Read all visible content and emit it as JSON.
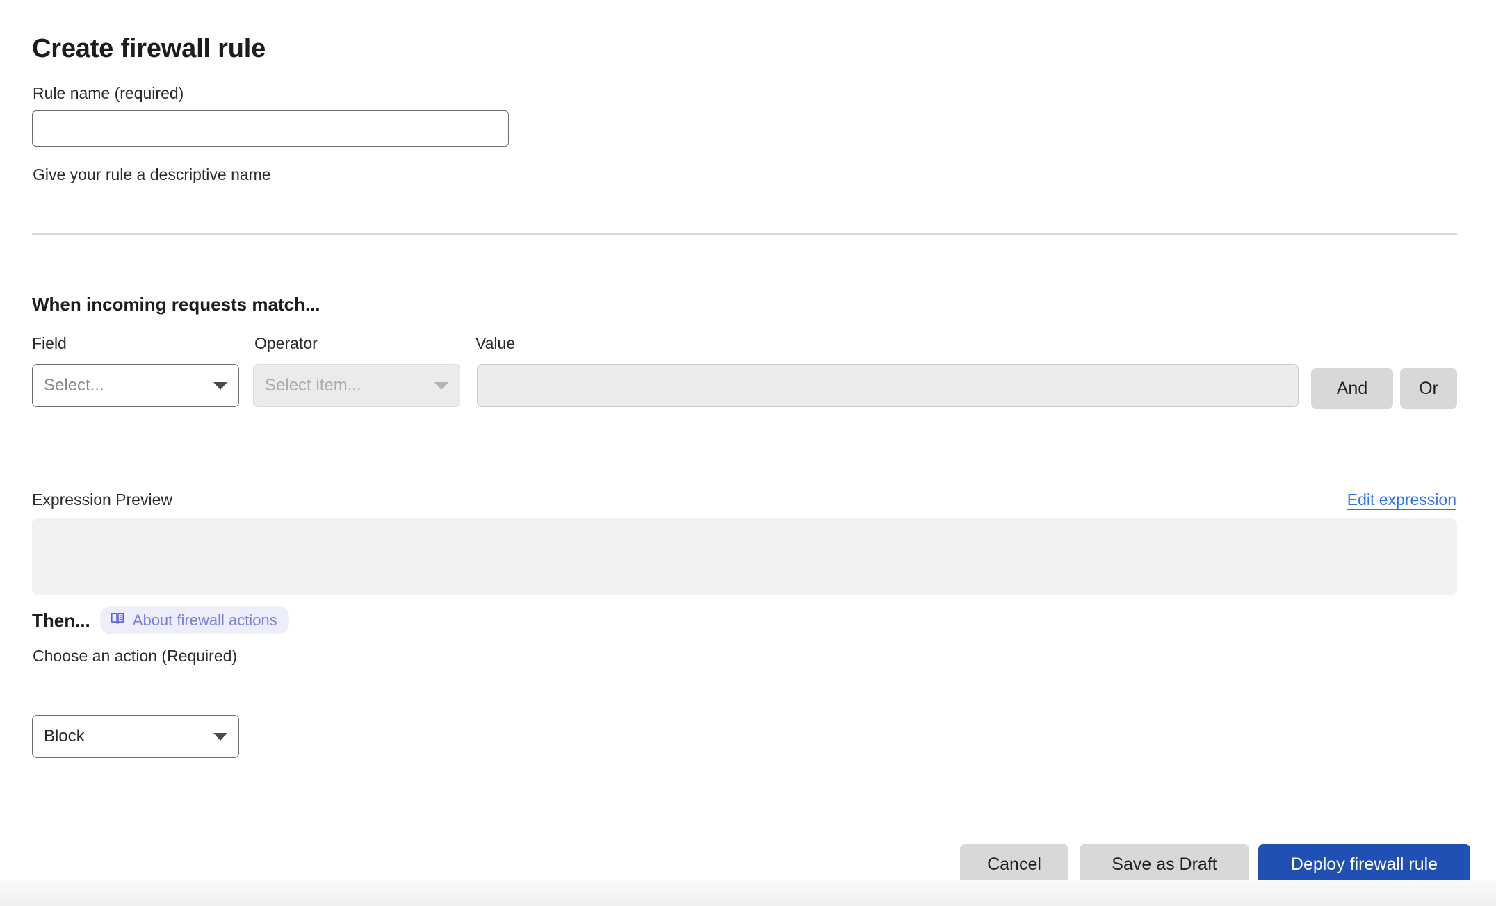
{
  "header": {
    "title": "Create firewall rule"
  },
  "rule_name": {
    "label": "Rule name (required)",
    "value": "",
    "placeholder": "",
    "help_text": "Give your rule a descriptive name"
  },
  "match_section": {
    "heading": "When incoming requests match...",
    "columns": {
      "field": "Field",
      "operator": "Operator",
      "value": "Value"
    },
    "field_select": {
      "value": "Select...",
      "state": "enabled"
    },
    "operator_select": {
      "value": "Select item...",
      "state": "disabled"
    },
    "value_input": {
      "value": "",
      "placeholder": "",
      "state": "disabled"
    },
    "logic_buttons": {
      "and": "And",
      "or": "Or"
    }
  },
  "expression": {
    "label": "Expression Preview",
    "edit_link": "Edit expression",
    "preview_text": ""
  },
  "then_section": {
    "heading": "Then...",
    "badge": {
      "icon": "book-icon",
      "label": "About firewall actions"
    },
    "action_label": "Choose an action (Required)",
    "action_select": {
      "value": "Block"
    }
  },
  "footer": {
    "cancel": "Cancel",
    "save_draft": "Save as Draft",
    "deploy": "Deploy firewall rule"
  },
  "colors": {
    "primary_button": "#2150b5",
    "link": "#2d72f0",
    "badge_bg": "#eeeefb",
    "badge_text": "#7b7fd4",
    "disabled_bg": "#ececec",
    "preview_bg": "#f1f1f1"
  }
}
